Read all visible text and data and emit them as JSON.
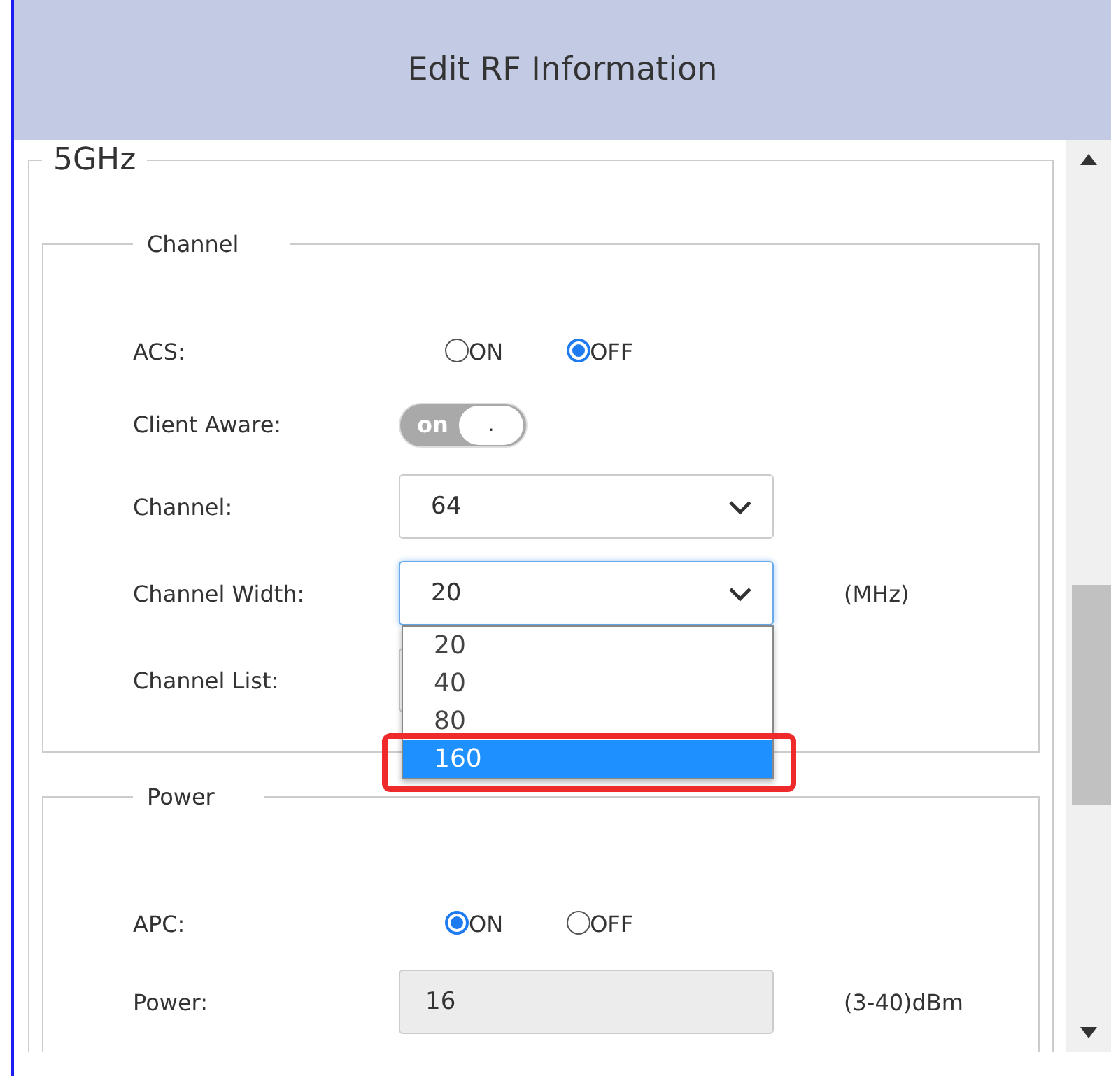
{
  "window": {
    "title": "Edit RF Information"
  },
  "band": {
    "legend": "5GHz",
    "groups": [
      {
        "legend": "Channel",
        "rows": [
          {
            "kind": "radio",
            "label": "ACS:",
            "options": [
              {
                "label": "ON",
                "selected": false
              },
              {
                "label": "OFF",
                "selected": true
              }
            ]
          },
          {
            "kind": "toggle",
            "label": "Client Aware:",
            "toggle": {
              "text": "on",
              "knob": ".",
              "on": false
            }
          },
          {
            "kind": "select",
            "label": "Channel:",
            "value": "64",
            "focused": false
          },
          {
            "kind": "select",
            "label": "Channel Width:",
            "value": "20",
            "unit": "(MHz)",
            "focused": true,
            "expanded": true,
            "options": [
              {
                "label": "20",
                "highlighted": false,
                "annotated": false
              },
              {
                "label": "40",
                "highlighted": false,
                "annotated": false
              },
              {
                "label": "80",
                "highlighted": false,
                "annotated": false
              },
              {
                "label": "160",
                "highlighted": true,
                "annotated": true
              }
            ]
          },
          {
            "kind": "select",
            "label": "Channel List:",
            "focused": false
          }
        ]
      },
      {
        "legend": "Power",
        "rows": [
          {
            "kind": "radio",
            "label": "APC:",
            "options": [
              {
                "label": "ON",
                "selected": true
              },
              {
                "label": "OFF",
                "selected": false
              }
            ]
          },
          {
            "kind": "input",
            "label": "Power:",
            "value": "16",
            "unit": "(3-40)dBm",
            "disabled": true
          }
        ]
      }
    ]
  }
}
